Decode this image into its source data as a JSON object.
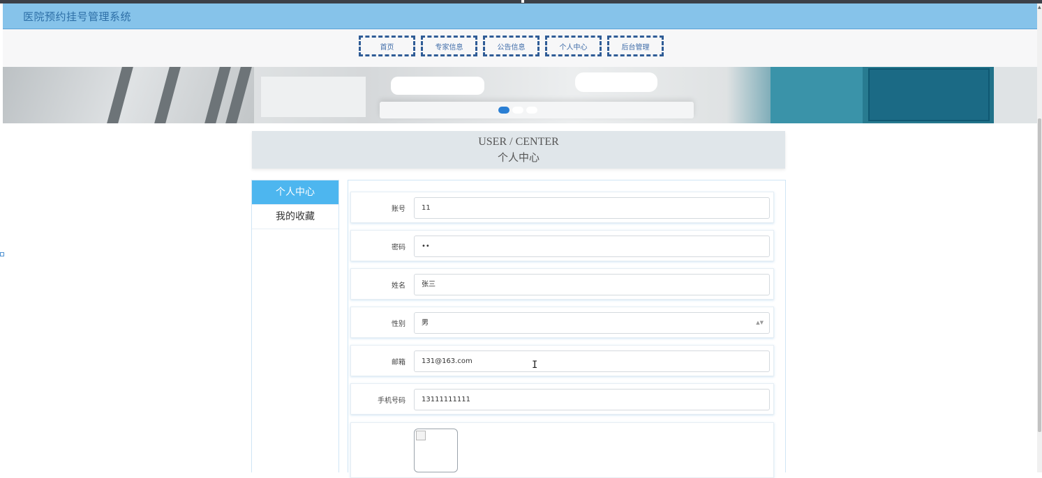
{
  "app": {
    "title": "医院预约挂号管理系统"
  },
  "nav": {
    "items": [
      "首页",
      "专家信息",
      "公告信息",
      "个人中心",
      "后台管理"
    ]
  },
  "banner": {
    "slide_count": 3,
    "active_slide": 1
  },
  "section": {
    "title_en": "USER / CENTER",
    "title_cn": "个人中心"
  },
  "sidebar": {
    "items": [
      {
        "label": "个人中心",
        "active": true
      },
      {
        "label": "我的收藏",
        "active": false
      }
    ]
  },
  "form": {
    "fields": [
      {
        "label": "账号",
        "value": "11"
      },
      {
        "label": "密码",
        "value": "••"
      },
      {
        "label": "姓名",
        "value": "张三"
      },
      {
        "label": "性别",
        "value": "男"
      },
      {
        "label": "邮箱",
        "value": "131@163.com"
      },
      {
        "label": "手机号码",
        "value": "13111111111"
      }
    ]
  },
  "colors": {
    "header_bg": "#86c3ea",
    "header_text": "#2d6fa7",
    "nav_border": "#2f5c96",
    "sidebar_active": "#4db6ef"
  },
  "icons": {
    "select_arrow": "caret-down-icon",
    "broken_image": "broken-image-icon",
    "text_cursor": "text-cursor-icon"
  }
}
